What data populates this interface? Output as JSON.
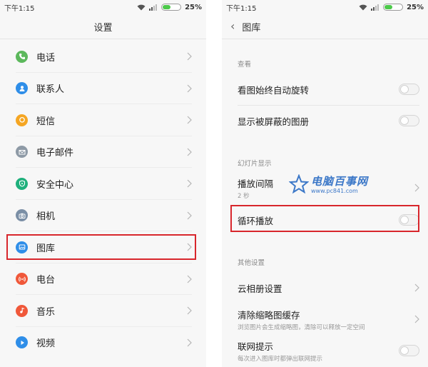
{
  "left": {
    "status": {
      "time": "下午1:15",
      "battery": "25%"
    },
    "title": "设置",
    "items": [
      {
        "label": "电话",
        "icon": "phone-icon",
        "color": "#5cb85c"
      },
      {
        "label": "联系人",
        "icon": "contacts-icon",
        "color": "#2f8ee8"
      },
      {
        "label": "短信",
        "icon": "message-icon",
        "color": "#f5a623"
      },
      {
        "label": "电子邮件",
        "icon": "mail-icon",
        "color": "#8e9aa6"
      },
      {
        "label": "安全中心",
        "icon": "shield-icon",
        "color": "#1fb07c"
      },
      {
        "label": "相机",
        "icon": "camera-icon",
        "color": "#7b8fa6"
      },
      {
        "label": "图库",
        "icon": "gallery-icon",
        "color": "#2f8ee8"
      },
      {
        "label": "电台",
        "icon": "radio-icon",
        "color": "#f0583a"
      },
      {
        "label": "音乐",
        "icon": "music-icon",
        "color": "#f0583a"
      },
      {
        "label": "视频",
        "icon": "video-icon",
        "color": "#2f8ee8"
      }
    ]
  },
  "right": {
    "status": {
      "time": "下午1:15",
      "battery": "25%"
    },
    "title": "图库",
    "sections": {
      "view": "查看",
      "slideshow": "幻灯片显示",
      "other": "其他设置"
    },
    "rows": {
      "auto_rotate": "看图始终自动旋转",
      "show_hidden": "显示被屏蔽的图册",
      "interval": {
        "label": "播放间隔",
        "value": "2 秒"
      },
      "loop": "循环播放",
      "cloud": "云相册设置",
      "clear_cache": {
        "label": "清除缩略图缓存",
        "desc": "浏览图片会生成缩略图，清除可以释放一定空间"
      },
      "network": {
        "label": "联网提示",
        "desc": "每次进入图库时都弹出联网提示"
      }
    }
  },
  "watermark": {
    "title": "电脑百事网",
    "url": "www.pc841.com"
  },
  "colors": {
    "highlight": "#d8262c",
    "accent": "#3c78c8"
  }
}
